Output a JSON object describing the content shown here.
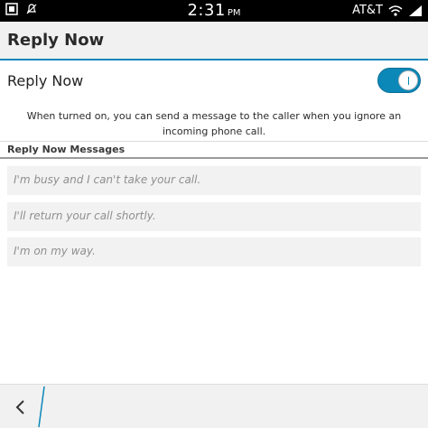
{
  "status_bar": {
    "time": "2:31",
    "ampm": "PM",
    "carrier": "AT&T",
    "icons": [
      "notification-icon",
      "mute-bell-icon",
      "wifi-icon",
      "signal-icon"
    ]
  },
  "header": {
    "title": "Reply Now"
  },
  "settings": {
    "toggle_label": "Reply Now",
    "toggle_on": true,
    "description": "When turned on, you can send a message to the caller when you ignore an incoming phone call."
  },
  "messages_section": {
    "header": "Reply Now Messages",
    "items": [
      "I'm busy and I can't take your call.",
      "I'll return your call shortly.",
      "I'm on my way."
    ]
  },
  "action_bar": {
    "back_icon": "chevron-left-icon"
  },
  "colors": {
    "accent": "#0b87b8",
    "status_bar": "#000000",
    "title_bar": "#f1f1f1",
    "item_bg": "#f2f2f2"
  }
}
